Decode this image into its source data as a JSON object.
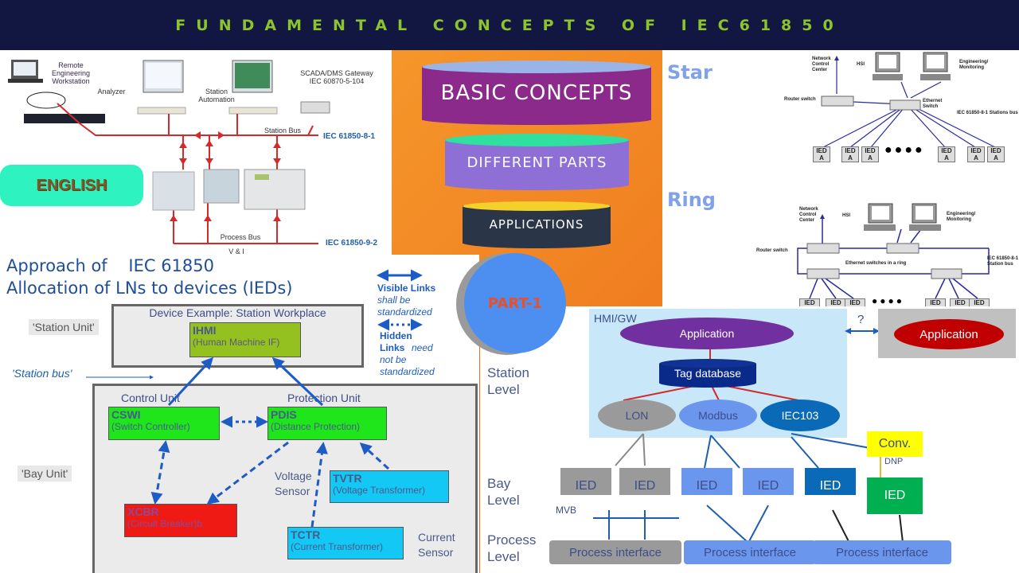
{
  "header": {
    "title": "FUNDAMENTAL CONCEPTS OF IEC61850"
  },
  "network_diagram": {
    "remote_ws": "Remote\nEngineering\nWorkstation",
    "analyzer": "Analyzer",
    "station_automation": "Station\nAutomation",
    "gateway": "SCADA/DMS Gateway\nIEC 60870-5-104",
    "station_bus": "Station Bus",
    "station_bus_std": "IEC 61850-8-1",
    "process_bus": "Process Bus",
    "vi": "V & I",
    "process_bus_std": "IEC 61850-9-2",
    "language_button": "ENGLISH"
  },
  "funnel": {
    "items": [
      "BASIC CONCEPTS",
      "DIFFERENT PARTS",
      "APPLICATIONS"
    ],
    "colors": [
      "#8b2a8a",
      "#8d6fd6",
      "#2a3548"
    ]
  },
  "part_badge": "PART-1",
  "topologies": {
    "star": {
      "title": "Star",
      "ncc": "Network\nControl\nCenter",
      "hsi": "HSI",
      "eng": "Engineering/\nMonitoring",
      "router": "Router switch",
      "switch": "Ethernet\nSwitch",
      "bus": "IEC 61850-8-1 Stations bus",
      "ied": "IED\nA",
      "ied_count": 7
    },
    "ring": {
      "title": "Ring",
      "ncc": "Network\nControl\nCenter",
      "hsi": "HSI",
      "eng": "Engineering/\nMonitoring",
      "router": "Router switch",
      "ring_label": "Ethernet switches in a ring",
      "bus": "IEC 61850-8-1\nStation bus",
      "ied": "IED",
      "ied_count": 6
    }
  },
  "approach": {
    "line1": "Approach of    IEC 61850",
    "line2": "Allocation of LNs to devices (IEDs)",
    "station_unit": "'Station Unit'",
    "station_bus": "'Station bus'",
    "bay_unit": "'Bay Unit'",
    "device_example": "Device Example: Station Workplace",
    "control_unit": "Control Unit",
    "protection_unit": "Protection Unit",
    "voltage_sensor": "Voltage\nSensor",
    "current_sensor": "Current\nSensor",
    "nodes": {
      "ihmi": {
        "code": "IHMI",
        "desc": "(Human Machine IF)"
      },
      "cswi": {
        "code": "CSWI",
        "desc": "(Switch Controller)"
      },
      "pdis": {
        "code": "PDIS",
        "desc": "(Distance Protection)"
      },
      "xcbr": {
        "code": "XCBR",
        "desc": "(Circuit Breaker)b"
      },
      "tvtr": {
        "code": "TVTR",
        "desc": "(Voltage Transformer)"
      },
      "tctr": {
        "code": "TCTR",
        "desc": "(Current Transformer)"
      }
    },
    "legend": {
      "visible_title": "Visible Links",
      "visible_desc": "shall be\nstandardized",
      "hidden_title": "Hidden\nLinks",
      "hidden_desc1": "need",
      "hidden_desc2": "not be\nstandardized"
    }
  },
  "levels": {
    "station_level": "Station\nLevel",
    "bay_level": "Bay\nLevel",
    "process_level": "Process\nLevel",
    "hmi_gw": "HMI/GW",
    "application": "Application",
    "tag_database": "Tag database",
    "protocols": [
      "LON",
      "Modbus",
      "IEC103"
    ],
    "question": "?",
    "remote_application": "Application",
    "conv": "Conv.",
    "dnp": "DNP",
    "mvb": "MVB",
    "ied": "IED",
    "process_interface": "Process interface"
  }
}
